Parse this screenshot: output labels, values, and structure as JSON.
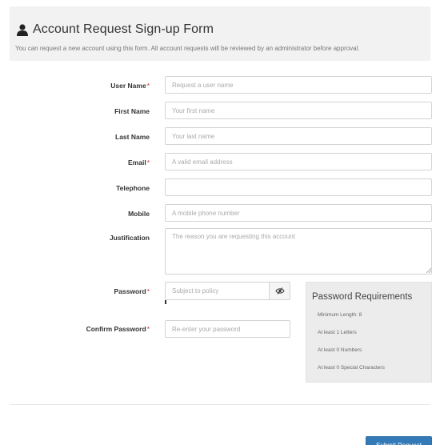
{
  "header": {
    "title": "Account Request Sign-up Form",
    "subtitle": "You can request a new account using this form. All account requests will be reviewed by an administrator before approval.",
    "icon": "user-icon"
  },
  "form": {
    "required_marker": "*",
    "fields": {
      "username": {
        "label": "User Name",
        "placeholder": "Request a user name",
        "value": ""
      },
      "first_name": {
        "label": "First Name",
        "placeholder": "Your first name",
        "value": ""
      },
      "last_name": {
        "label": "Last Name",
        "placeholder": "Your last name",
        "value": ""
      },
      "email": {
        "label": "Email",
        "placeholder": "A valid email address",
        "value": ""
      },
      "telephone": {
        "label": "Telephone",
        "placeholder": "",
        "value": ""
      },
      "mobile": {
        "label": "Mobile",
        "placeholder": "A mobile phone number",
        "value": ""
      },
      "justification": {
        "label": "Justification",
        "placeholder": "The reason you are requesting this account",
        "value": ""
      },
      "password": {
        "label": "Password",
        "placeholder": "Subject to policy",
        "value": "",
        "toggle_icon": "eye-icon"
      },
      "confirm_password": {
        "label": "Confirm Password",
        "placeholder": "Re-enter your password",
        "value": ""
      }
    },
    "submit_label": "Submit Request"
  },
  "password_requirements": {
    "title": "Password Requirements",
    "items": [
      "Minimum Length: 8",
      "At least 1 Letters",
      "At least 0 Numbers",
      "At least 0 Special Characters"
    ]
  },
  "colors": {
    "required": "#c9302c",
    "primary": "#337ab7",
    "header_bg": "#f2f2f2",
    "panel_bg": "#ececec"
  }
}
